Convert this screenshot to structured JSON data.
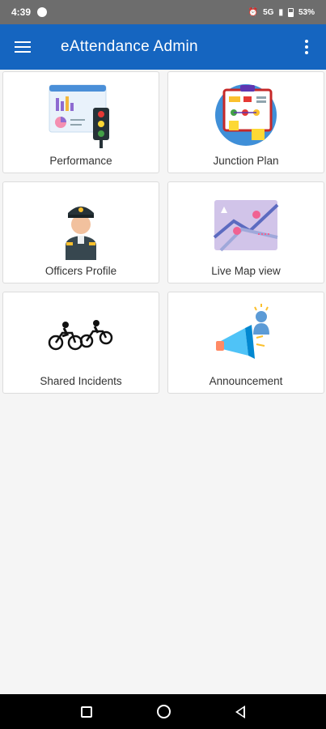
{
  "status_bar": {
    "time": "4:39",
    "indicators": "5G",
    "battery": "53%"
  },
  "app_bar": {
    "title": "eAttendance Admin"
  },
  "tiles": [
    {
      "label": "Performance",
      "icon": "performance-icon"
    },
    {
      "label": "Junction Plan",
      "icon": "junction-plan-icon"
    },
    {
      "label": "Officers Profile",
      "icon": "officer-icon"
    },
    {
      "label": "Live Map view",
      "icon": "map-icon"
    },
    {
      "label": "Shared Incidents",
      "icon": "motorcycle-incident-icon"
    },
    {
      "label": "Announcement",
      "icon": "megaphone-icon"
    }
  ],
  "colors": {
    "app_bar": "#1565c0",
    "status_bar": "#6d6d6d",
    "background": "#f5f5f5"
  }
}
